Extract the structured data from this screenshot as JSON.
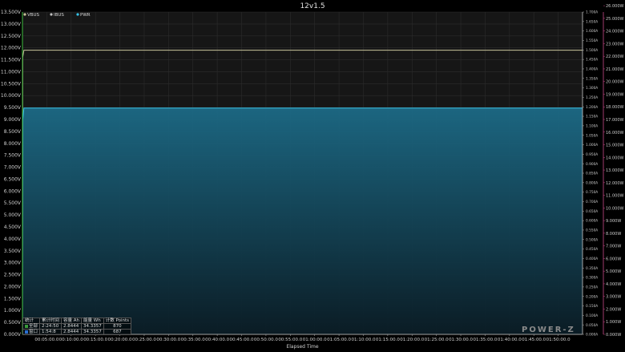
{
  "chart_data": {
    "type": "area",
    "title": "12v1.5",
    "xlabel": "Elapsed Time",
    "legend_position": "top-left",
    "x_ticks": [
      "00:05:00.0",
      "00:10:00.0",
      "00:15:00.0",
      "00:20:00.0",
      "00:25:00.0",
      "00:30:00.0",
      "00:35:00.0",
      "00:40:00.0",
      "00:45:00.0",
      "00:50:00.0",
      "00:55:00.0",
      "01:00:00.0",
      "01:05:00.0",
      "01:10:00.0",
      "01:15:00.0",
      "01:20:00.0",
      "01:25:00.0",
      "01:30:00.0",
      "01:35:00.0",
      "01:40:00.0",
      "01:45:00.0",
      "01:50:00.0"
    ],
    "x_range_minutes": [
      0,
      115
    ],
    "left_axis": {
      "min": 0,
      "max": 13.5,
      "step": 0.5,
      "decimals": 3,
      "unit": "V"
    },
    "right_axis_current": {
      "min": 0,
      "max": 1.7,
      "step": 0.05,
      "decimals": 3,
      "unit": "A"
    },
    "right_axis_power": {
      "min": 0,
      "max": 25.5,
      "step": 1.0,
      "decimals": 3,
      "unit": "W"
    },
    "grid": true,
    "series": [
      {
        "name": "VBUS",
        "color": "#c8c39b",
        "axis": "left",
        "points": [
          [
            0,
            0
          ],
          [
            0.05,
            11.6
          ],
          [
            0.3,
            11.9
          ],
          [
            115,
            11.9
          ]
        ]
      },
      {
        "name": "IBUS",
        "color": "#c0c0c0",
        "axis": "current",
        "points": [
          [
            0,
            0
          ],
          [
            115,
            0
          ]
        ]
      },
      {
        "name": "PWR",
        "color": "#35c3e8",
        "axis": "power",
        "fill": true,
        "points": [
          [
            0,
            0
          ],
          [
            0.05,
            16.9
          ],
          [
            0.3,
            17.9
          ],
          [
            115,
            17.9
          ]
        ]
      }
    ]
  },
  "stats_table": {
    "header": [
      "统计",
      "累计时间",
      "容量 Ah",
      "能量 Wh",
      "计数 Points"
    ],
    "rows": [
      {
        "label": "全部",
        "color": "#3a9b3a",
        "time": "2:24:50",
        "ah": "2.8444",
        "wh": "34.3357",
        "points": "870"
      },
      {
        "label": "窗口",
        "color": "#2b6fd1",
        "time": "1:54:8",
        "ah": "2.8444",
        "wh": "34.3357",
        "points": "687"
      }
    ]
  },
  "brand": "POWER-Z"
}
